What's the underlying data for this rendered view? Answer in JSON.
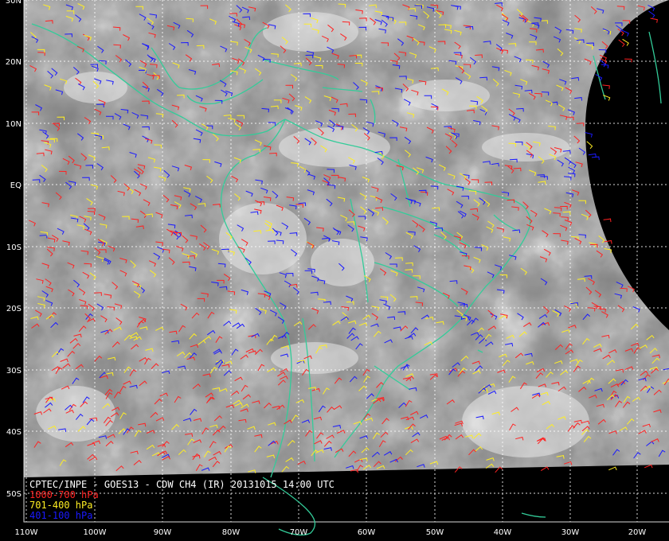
{
  "map": {
    "title": "CPTEC/INPE - GOES13 - CDW CH4 (IR) 20131015 14:00 UTC",
    "latitude_labels": [
      "30N",
      "20N",
      "10N",
      "EQ",
      "10S",
      "20S",
      "30S",
      "40S",
      "50S"
    ],
    "longitude_labels": [
      "110W",
      "100W",
      "90W",
      "80W",
      "70W",
      "60W",
      "50W",
      "40W",
      "30W",
      "20W"
    ],
    "colors": {
      "background": "#000000",
      "coastline": "#33cc99",
      "gridline": "#ffffff",
      "cloud_image": "#8a8a8a"
    }
  },
  "legend": {
    "items": [
      {
        "label": "1000-700 hPa",
        "color": "#ff2222"
      },
      {
        "label": "701-400 hPa",
        "color": "#ffee22"
      },
      {
        "label": "401-100 hPa",
        "color": "#1a1aff"
      }
    ]
  }
}
